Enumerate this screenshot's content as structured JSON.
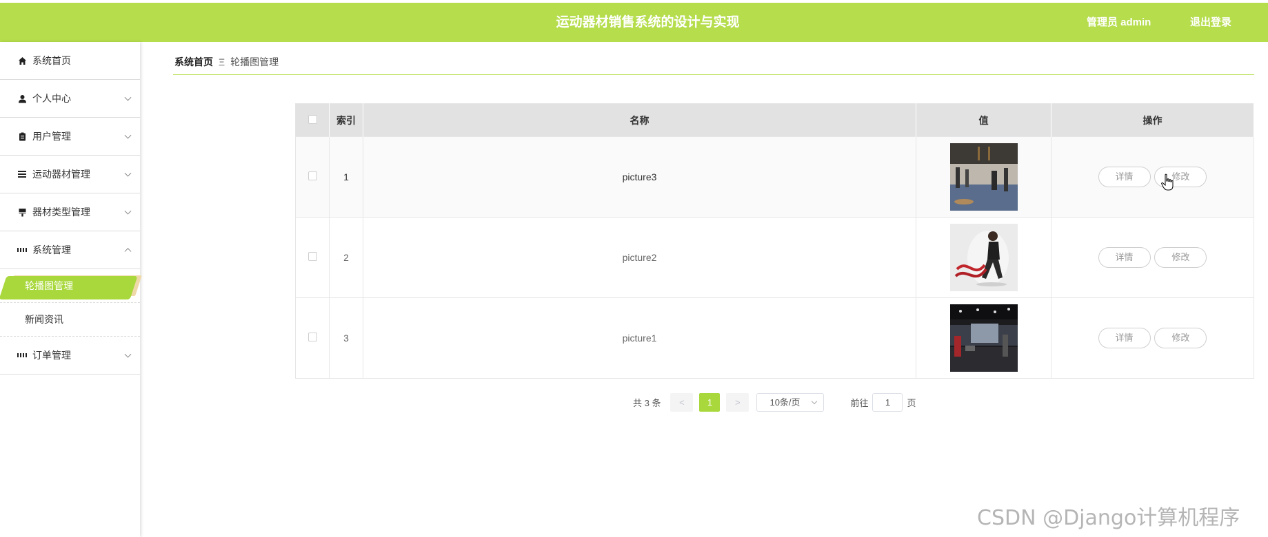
{
  "header": {
    "title": "运动器材销售系统的设计与实现",
    "user": "管理员 admin",
    "logout": "退出登录",
    "bg_color": "#b5dd4c"
  },
  "sidebar": {
    "items": [
      {
        "label": "系统首页",
        "icon": "home-icon"
      },
      {
        "label": "个人中心",
        "icon": "user-icon"
      },
      {
        "label": "用户管理",
        "icon": "clipboard-icon"
      },
      {
        "label": "运动器材管理",
        "icon": "list-icon"
      },
      {
        "label": "器材类型管理",
        "icon": "brush-icon"
      },
      {
        "label": "系统管理",
        "icon": "grid-icon"
      },
      {
        "label": "订单管理",
        "icon": "grid-icon"
      }
    ],
    "sub_items": [
      {
        "label": "轮播图管理",
        "active": true
      },
      {
        "label": "新闻资讯",
        "active": false
      }
    ]
  },
  "breadcrumb": {
    "home": "系统首页",
    "separator": "Ξ",
    "current": "轮播图管理"
  },
  "table": {
    "columns": [
      "索引",
      "名称",
      "值",
      "操作"
    ],
    "rows": [
      {
        "index": "1",
        "name": "picture3",
        "image": "gym-interior-image"
      },
      {
        "index": "2",
        "name": "picture2",
        "image": "battle-rope-image"
      },
      {
        "index": "3",
        "name": "picture1",
        "image": "gym-floor-image"
      }
    ],
    "detail_label": "详情",
    "edit_label": "修改"
  },
  "pagination": {
    "total": "共 3 条",
    "prev": "<",
    "page": "1",
    "next": ">",
    "page_size": "10条/页",
    "goto_prefix": "前往",
    "goto_value": "1",
    "goto_suffix": "页",
    "accent_color": "#a9d83d"
  },
  "watermark": "CSDN @Django计算机程序"
}
